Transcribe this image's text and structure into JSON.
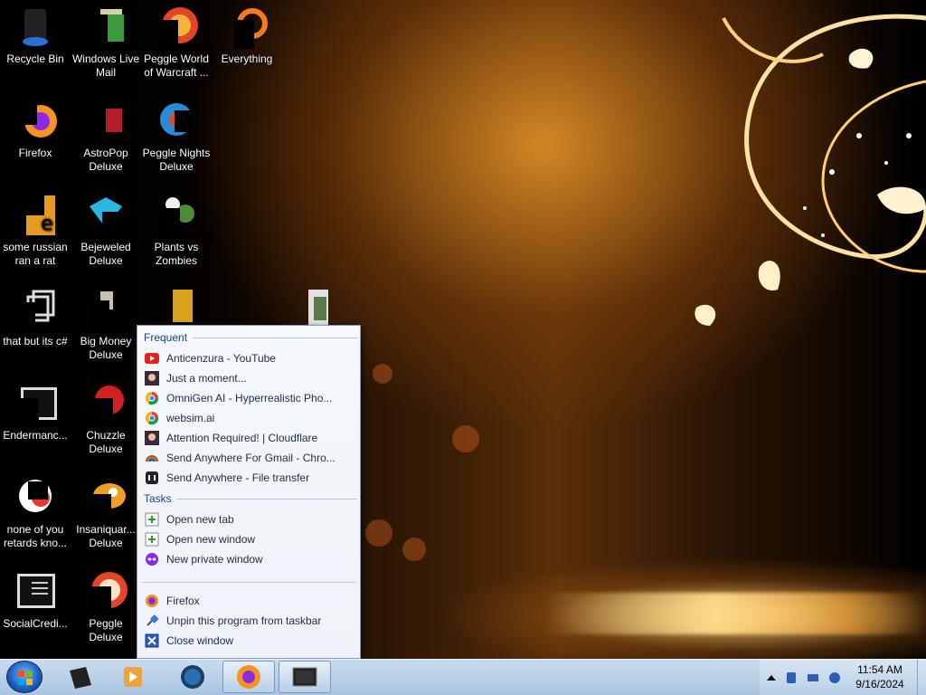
{
  "desktop_icons": [
    {
      "label": "Recycle Bin",
      "icon": "recycle-bin-icon"
    },
    {
      "label": "Windows Live Mail",
      "icon": "mail-icon"
    },
    {
      "label": "Peggle World of Warcraft ...",
      "icon": "peggle-icon"
    },
    {
      "label": "Everything",
      "icon": "search-icon"
    },
    {
      "label": "Firefox",
      "icon": "firefox-icon"
    },
    {
      "label": "AstroPop Deluxe",
      "icon": "astropop-icon"
    },
    {
      "label": "Peggle Nights Deluxe",
      "icon": "peggle-nights-icon"
    },
    {
      "label": "some russian ran a rat",
      "icon": "file-icon"
    },
    {
      "label": "Bejeweled Deluxe",
      "icon": "bejeweled-icon"
    },
    {
      "label": "Plants vs Zombies",
      "icon": "plants-icon"
    },
    {
      "label": "that but its c#",
      "icon": "shortcut-icon"
    },
    {
      "label": "Big Money Deluxe",
      "icon": "big-money-icon"
    },
    {
      "label": "Endermanc...",
      "icon": "terminal-icon"
    },
    {
      "label": "Chuzzle Deluxe",
      "icon": "chuzzle-icon"
    },
    {
      "label": "none of you retards kno...",
      "icon": "app-icon"
    },
    {
      "label": "Insaniquar... Deluxe",
      "icon": "fish-icon"
    },
    {
      "label": "SocialCredi...",
      "icon": "terminal-icon"
    },
    {
      "label": "Peggle Deluxe",
      "icon": "peggle-icon"
    }
  ],
  "jumplist": {
    "frequent_header": "Frequent",
    "frequent": [
      {
        "label": "Anticenzura - YouTube",
        "icon": "youtube-icon"
      },
      {
        "label": "Just a moment...",
        "icon": "page-icon"
      },
      {
        "label": "OmniGen AI - Hyperrealistic Pho...",
        "icon": "chrome-icon"
      },
      {
        "label": "websim.ai",
        "icon": "chrome-icon"
      },
      {
        "label": "Attention Required! | Cloudflare",
        "icon": "page-icon"
      },
      {
        "label": "Send Anywhere For Gmail - Chro...",
        "icon": "rainbow-icon"
      },
      {
        "label": "Send Anywhere - File transfer",
        "icon": "send-anywhere-icon"
      }
    ],
    "tasks_header": "Tasks",
    "tasks": [
      {
        "label": "Open new tab",
        "icon": "new-tab-icon"
      },
      {
        "label": "Open new window",
        "icon": "new-window-icon"
      },
      {
        "label": "New private window",
        "icon": "private-window-icon"
      }
    ],
    "bottom": [
      {
        "label": "Firefox",
        "icon": "firefox-icon"
      },
      {
        "label": "Unpin this program from taskbar",
        "icon": "pin-icon"
      },
      {
        "label": "Close window",
        "icon": "close-icon"
      }
    ]
  },
  "taskbar": {
    "clock_time": "11:54 AM",
    "clock_date": "9/16/2024"
  },
  "colors": {
    "jumplist_header": "#1e3f8a",
    "jumplist_text": "#1c2b4a",
    "taskbar": "#b9cfe6"
  }
}
